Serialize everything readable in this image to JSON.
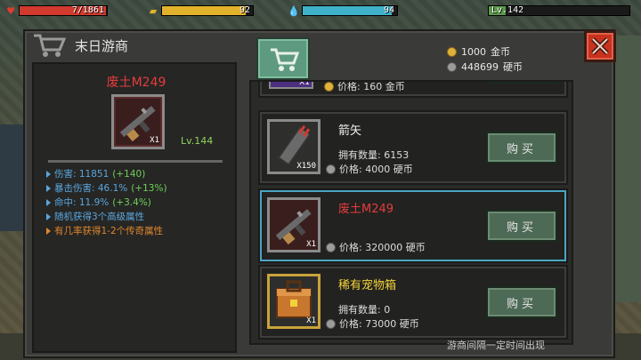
{
  "hud": {
    "health": {
      "value": "7/1861",
      "fill_pct": 99,
      "color": "#d23a2e"
    },
    "energy": {
      "value": "92",
      "fill_pct": 92,
      "color": "#e3b22b"
    },
    "water": {
      "value": "94",
      "fill_pct": 94,
      "color": "#3fb1c8"
    },
    "level": {
      "value": "Lv.142",
      "fill_pct": 12,
      "color": "#5a9a4a"
    }
  },
  "shop": {
    "title": "末日游商",
    "currency": {
      "gold": {
        "amount": "1000",
        "unit": "金币",
        "icon": "gold-coin-icon",
        "color": "#e0b23a"
      },
      "silver": {
        "amount": "448699",
        "unit": "硬币",
        "icon": "silver-coin-icon",
        "color": "#9c9c9c"
      }
    },
    "footer_note": "游商间隔一定时间出现"
  },
  "selected_item": {
    "name": "废土M249",
    "qty": "X1",
    "level": "Lv.144",
    "stats": [
      {
        "text": "伤害: 11851 ",
        "bonus": "(+140)",
        "color": "#5aa7e0"
      },
      {
        "text": "暴击伤害: 46.1% ",
        "bonus": "(+13%)",
        "color": "#5aa7e0"
      },
      {
        "text": "命中: 11.9% ",
        "bonus": "(+3.4%)",
        "color": "#5aa7e0"
      },
      {
        "text": "随机获得3个高级属性",
        "bonus": "",
        "color": "#5aa7e0"
      },
      {
        "text": "有几率获得1-2个传奇属性",
        "bonus": "",
        "color": "#e0872e"
      }
    ]
  },
  "list": {
    "partial_top": {
      "qty": "X1",
      "price": "价格: 160 金币",
      "icon": "purple-item-icon"
    },
    "items": [
      {
        "name": "箭矢",
        "name_color": "#f0f0f0",
        "owned": "拥有数量: 6153",
        "price": "价格: 4000 硬币",
        "qty": "X150",
        "buy": "购买",
        "icon": "arrows-icon",
        "selected": false
      },
      {
        "name": "废土M249",
        "name_color": "#e53c3c",
        "owned": "",
        "price": "价格: 320000 硬币",
        "qty": "X1",
        "buy": "购买",
        "icon": "machine-gun-icon",
        "selected": true
      },
      {
        "name": "稀有宠物箱",
        "name_color": "#f2d23a",
        "owned": "拥有数量: 0",
        "price": "价格: 73000 硬币",
        "qty": "X1",
        "buy": "购买",
        "icon": "pet-box-icon",
        "selected": false
      }
    ]
  }
}
